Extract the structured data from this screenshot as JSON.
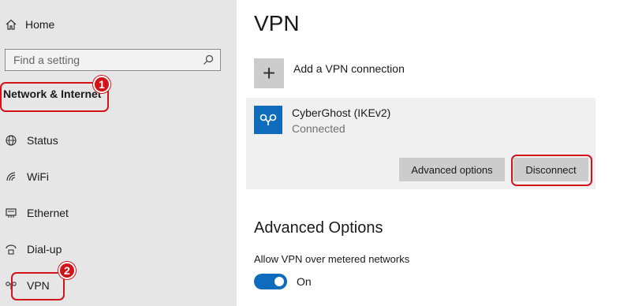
{
  "sidebar": {
    "home_label": "Home",
    "search_placeholder": "Find a setting",
    "section_title": "Network & Internet",
    "items": [
      {
        "label": "Status",
        "icon": "globe-icon"
      },
      {
        "label": "WiFi",
        "icon": "wifi-icon"
      },
      {
        "label": "Ethernet",
        "icon": "ethernet-icon"
      },
      {
        "label": "Dial-up",
        "icon": "dialup-icon"
      },
      {
        "label": "VPN",
        "icon": "vpn-icon"
      }
    ]
  },
  "annotations": {
    "badge1": "1",
    "badge2": "2",
    "highlight_color": "#d0141a"
  },
  "main": {
    "title": "VPN",
    "add_label": "Add a VPN connection",
    "add_icon": "+",
    "connection": {
      "name": "CyberGhost (IKEv2)",
      "status": "Connected",
      "advanced_button": "Advanced options",
      "disconnect_button": "Disconnect"
    },
    "advanced_heading": "Advanced Options",
    "metered_label": "Allow VPN over metered networks",
    "metered_state": "On",
    "accent_color": "#0f6cbd"
  }
}
